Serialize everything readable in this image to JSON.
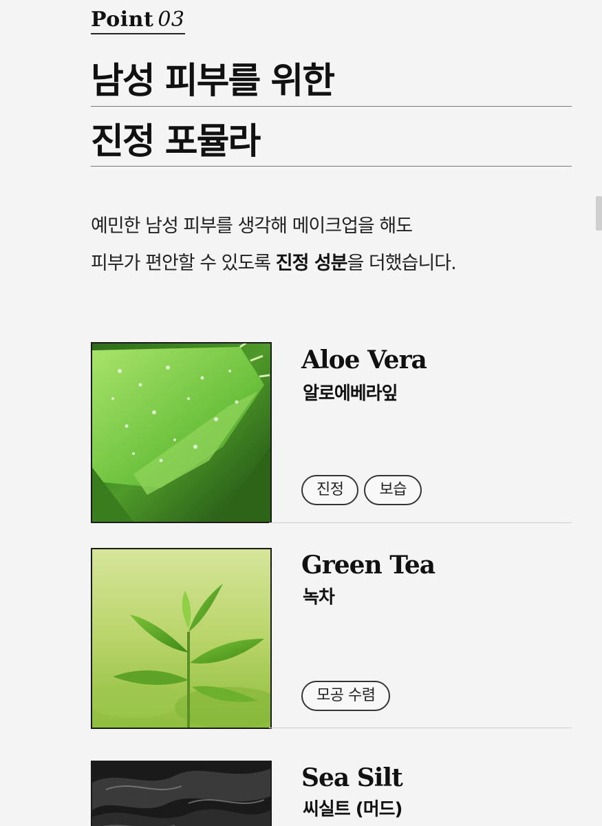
{
  "section_label": {
    "point": "Point",
    "number": "03"
  },
  "headline": {
    "line1": "남성 피부를 위한",
    "line2": "진정 포뮬라"
  },
  "description": {
    "line1": "예민한 남성 피부를 생각해 메이크업을 해도",
    "line2_before": "피부가 편안할 수 있도록 ",
    "line2_bold": "진정 성분",
    "line2_after": "을 더했습니다."
  },
  "ingredients": [
    {
      "name_en": "Aloe Vera",
      "name_ko": "알로에베라잎",
      "tags": [
        "진정",
        "보습"
      ],
      "image": "aloe-leaf-image"
    },
    {
      "name_en": "Green Tea",
      "name_ko": "녹차",
      "tags": [
        "모공 수렴"
      ],
      "image": "green-tea-image"
    },
    {
      "name_en": "Sea Silt",
      "name_ko": "씨실트 (머드)",
      "tags": [],
      "image": "sea-silt-mud-image"
    }
  ],
  "colors": {
    "background": "#f4f4f4",
    "text": "#111111",
    "rule": "#777777"
  }
}
